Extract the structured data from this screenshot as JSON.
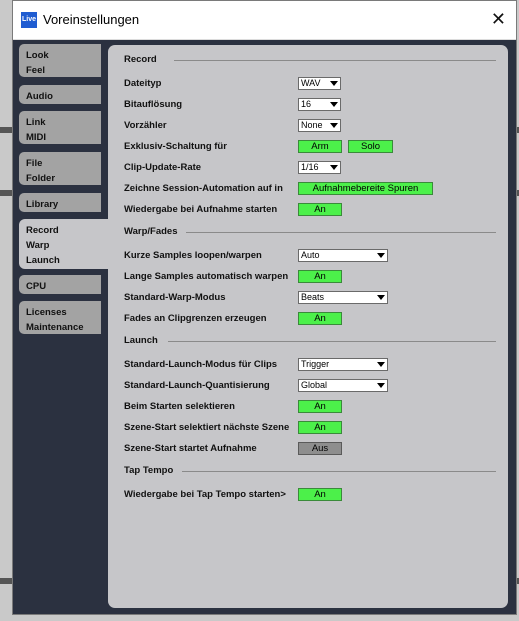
{
  "window": {
    "title": "Voreinstellungen",
    "app_icon_text": "Live"
  },
  "sidebar": {
    "tabs": [
      {
        "lines": [
          "Look",
          "Feel"
        ]
      },
      {
        "lines": [
          "Audio"
        ]
      },
      {
        "lines": [
          "Link",
          "MIDI"
        ]
      },
      {
        "lines": [
          "File",
          "Folder"
        ]
      },
      {
        "lines": [
          "Library"
        ]
      },
      {
        "lines": [
          "Record",
          "Warp",
          "Launch"
        ],
        "active": true
      },
      {
        "lines": [
          "CPU"
        ]
      },
      {
        "lines": [
          "Licenses",
          "Maintenance"
        ]
      }
    ]
  },
  "sections": {
    "record": "Record",
    "warp": "Warp/Fades",
    "launch": "Launch",
    "tap": "Tap Tempo"
  },
  "record": {
    "dateityp": {
      "label": "Dateityp",
      "value": "WAV"
    },
    "bitaufloesung": {
      "label": "Bitauflösung",
      "value": "16"
    },
    "vorzaehler": {
      "label": "Vorzähler",
      "value": "None"
    },
    "exklusiv": {
      "label": "Exklusiv-Schaltung für",
      "arm": "Arm",
      "solo": "Solo"
    },
    "clip_update": {
      "label": "Clip-Update-Rate",
      "value": "1/16"
    },
    "zeichne": {
      "label": "Zeichne Session-Automation auf in",
      "value": "Aufnahmebereite Spuren"
    },
    "wiedergabe": {
      "label": "Wiedergabe bei Aufnahme starten",
      "value": "An"
    }
  },
  "warp": {
    "kurze": {
      "label": "Kurze Samples loopen/warpen",
      "value": "Auto"
    },
    "lange": {
      "label": "Lange Samples automatisch warpen",
      "value": "An"
    },
    "modus": {
      "label": "Standard-Warp-Modus",
      "value": "Beats"
    },
    "fades": {
      "label": "Fades an Clipgrenzen erzeugen",
      "value": "An"
    }
  },
  "launch": {
    "modus": {
      "label": "Standard-Launch-Modus für Clips",
      "value": "Trigger"
    },
    "quant": {
      "label": "Standard-Launch-Quantisierung",
      "value": "Global"
    },
    "beim_starten": {
      "label": "Beim Starten selektieren",
      "value": "An"
    },
    "szene_naechste": {
      "label": "Szene-Start selektiert nächste Szene",
      "value": "An"
    },
    "szene_aufnahme": {
      "label": "Szene-Start startet Aufnahme",
      "value": "Aus"
    }
  },
  "tap": {
    "wiedergabe": {
      "label": "Wiedergabe bei Tap Tempo starten>",
      "value": "An"
    }
  },
  "colors": {
    "on": "#4cf04a",
    "off": "#8e8e8e",
    "panel": "#c6c6c9",
    "frame": "#2b3140"
  }
}
